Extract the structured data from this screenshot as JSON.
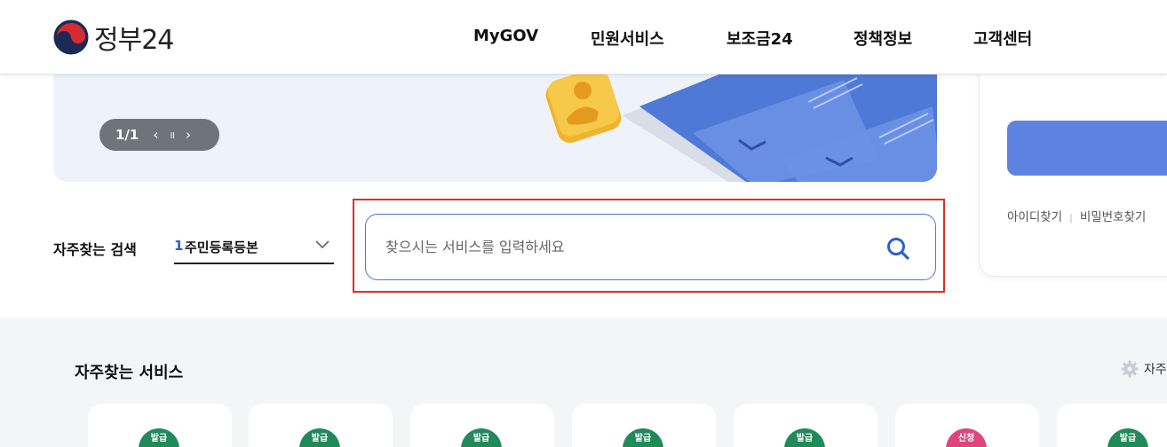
{
  "header": {
    "logo_text": "정부24",
    "nav": [
      {
        "label": "MyGOV"
      },
      {
        "label": "민원서비스"
      },
      {
        "label": "보조금24"
      },
      {
        "label": "정책정보"
      },
      {
        "label": "고객센터"
      }
    ]
  },
  "banner": {
    "pager_count": "1/1",
    "prev": "‹",
    "pause": "॥",
    "next": "›"
  },
  "login": {
    "links": [
      "아이디찾기",
      "비밀번호찾기"
    ]
  },
  "search": {
    "faq_label": "자주찾는 검색",
    "faq_rank": "1",
    "faq_value": "주민등록등본",
    "placeholder": "찾으시는 서비스를 입력하세요",
    "value": ""
  },
  "services": {
    "title": "자주찾는 서비스",
    "setting_label": "자주",
    "cards": [
      {
        "badge": "발급",
        "color": "#1f8a5a"
      },
      {
        "badge": "발급",
        "color": "#1f8a5a"
      },
      {
        "badge": "발급",
        "color": "#1f8a5a"
      },
      {
        "badge": "발급",
        "color": "#1f8a5a"
      },
      {
        "badge": "발급",
        "color": "#1f8a5a"
      },
      {
        "badge": "신청",
        "color": "#e0457b"
      },
      {
        "badge": "발급",
        "color": "#1f8a5a"
      }
    ]
  },
  "colors": {
    "accent": "#5d82e0",
    "search_border": "#4a78d8",
    "highlight": "#d9302a"
  }
}
